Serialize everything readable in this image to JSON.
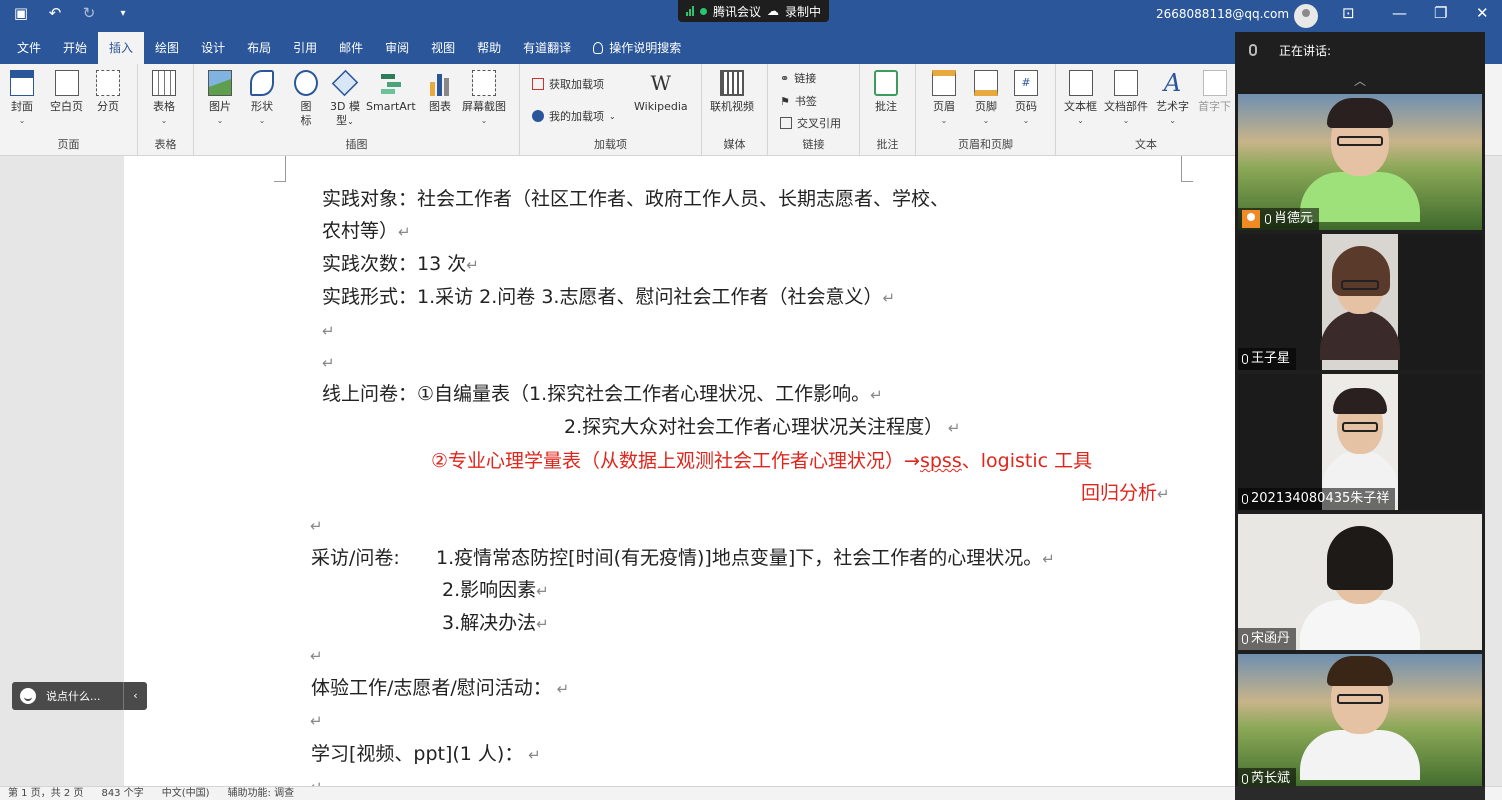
{
  "app": {
    "account": "2668088118@qq.com",
    "meeting_name": "腾讯会议",
    "recording": "录制中"
  },
  "tabs": [
    "文件",
    "开始",
    "插入",
    "绘图",
    "设计",
    "布局",
    "引用",
    "邮件",
    "审阅",
    "视图",
    "帮助",
    "有道翻译"
  ],
  "active_tab": "插入",
  "tell_me": "操作说明搜索",
  "ribbon": {
    "pages": {
      "label": "页面",
      "cover": "封面",
      "blank": "空白页",
      "break": "分页"
    },
    "tables": {
      "label": "表格",
      "table": "表格"
    },
    "illus": {
      "label": "插图",
      "picture": "图片",
      "shape": "形状",
      "icon1": "图",
      "icon2": "标",
      "model1": "3D 模",
      "model2": "型",
      "smartart": "SmartArt",
      "chart": "图表",
      "screenshot": "屏幕截图"
    },
    "addins": {
      "label": "加载项",
      "get": "获取加载项",
      "mine": "我的加载项",
      "wiki": "Wikipedia"
    },
    "media": {
      "label": "媒体",
      "video": "联机视频"
    },
    "links": {
      "label": "链接",
      "link": "链接",
      "bookmark": "书签",
      "xref": "交叉引用"
    },
    "comments": {
      "label": "批注",
      "comment": "批注"
    },
    "hf": {
      "label": "页眉和页脚",
      "header": "页眉",
      "footer": "页脚",
      "pageno": "页码"
    },
    "text": {
      "label": "文本",
      "textbox": "文本框",
      "parts": "文档部件",
      "wordart": "艺术字",
      "dropcap": "首字下"
    }
  },
  "document": {
    "l1a": "实践对象：社会工作者（社区工作者、政府工作人员、长期志愿者、学校、",
    "l1b": "农村等）",
    "l2": "实践次数：13 次",
    "l3": "实践形式：1.采访  2.问卷  3.志愿者、慰问社会工作者（社会意义）",
    "l4": "线上问卷：①自编量表（1.探究社会工作者心理状况、工作影响。",
    "l5": "2.探究大众对社会工作者心理状况关注程度）",
    "l6a": "②专业心理学量表（从数据上观测社会工作者心理状况）→",
    "l6b": "spss",
    "l6c": "、logistic 工具",
    "l7": "回归分析",
    "l8": "采访/问卷:      1.疫情常态防控[时间(有无疫情)]地点变量]下，社会工作者的心理状况。",
    "l9": "2.影响因素",
    "l10": "3.解决办法",
    "l11": "体验工作/志愿者/慰问活动：",
    "l12": "学习[视频、ppt](1 人)："
  },
  "chat_hint": "说点什么...",
  "status": {
    "page": "第 1 页，共 2 页",
    "words": "843 个字",
    "lang": "中文(中国)",
    "access": "辅助功能: 调查"
  },
  "panel": {
    "speaking": "正在讲话:",
    "participants": [
      "肖德元",
      "王子星",
      "202134080435朱子祥",
      "宋函丹",
      "芮长斌"
    ]
  }
}
